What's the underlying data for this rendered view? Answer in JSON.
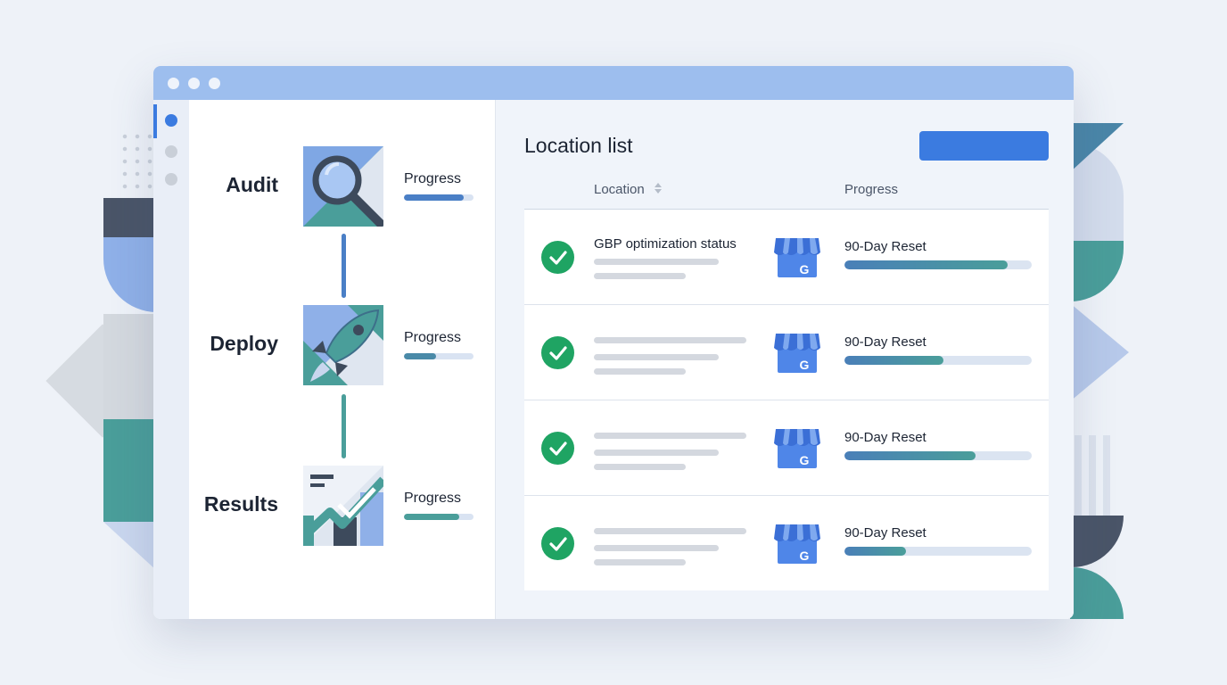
{
  "colors": {
    "accent": "#3b7be0",
    "success": "#1fa463",
    "teal": "#4a9e9a",
    "titlebar": "#9dbeee"
  },
  "rail": {
    "items": [
      {
        "icon": "active-nav-dot-icon",
        "active": true
      },
      {
        "icon": "nav-dot-icon",
        "active": false
      },
      {
        "icon": "nav-dot-icon",
        "active": false
      }
    ]
  },
  "steps": [
    {
      "label": "Audit",
      "icon": "magnifier-icon",
      "progress_label": "Progress",
      "progress": 0.86,
      "color": "#4a7fc6"
    },
    {
      "label": "Deploy",
      "icon": "rocket-icon",
      "progress_label": "Progress",
      "progress": 0.46,
      "color": "#4a8aa8"
    },
    {
      "label": "Results",
      "icon": "chart-check-icon",
      "progress_label": "Progress",
      "progress": 0.8,
      "color": "#4a9e9a"
    }
  ],
  "main": {
    "title": "Location list",
    "columns": {
      "location": "Location",
      "progress": "Progress"
    },
    "rows": [
      {
        "title": "GBP optimization status",
        "icon": "google-business-store-icon",
        "progress_label": "90-Day Reset",
        "progress": 0.87,
        "status": "check-circle-icon"
      },
      {
        "title": "",
        "icon": "google-business-store-icon",
        "progress_label": "90-Day Reset",
        "progress": 0.53,
        "status": "check-circle-icon"
      },
      {
        "title": "",
        "icon": "google-business-store-icon",
        "progress_label": "90-Day Reset",
        "progress": 0.7,
        "status": "check-circle-icon"
      },
      {
        "title": "",
        "icon": "google-business-store-icon",
        "progress_label": "90-Day Reset",
        "progress": 0.33,
        "status": "check-circle-icon"
      }
    ]
  }
}
